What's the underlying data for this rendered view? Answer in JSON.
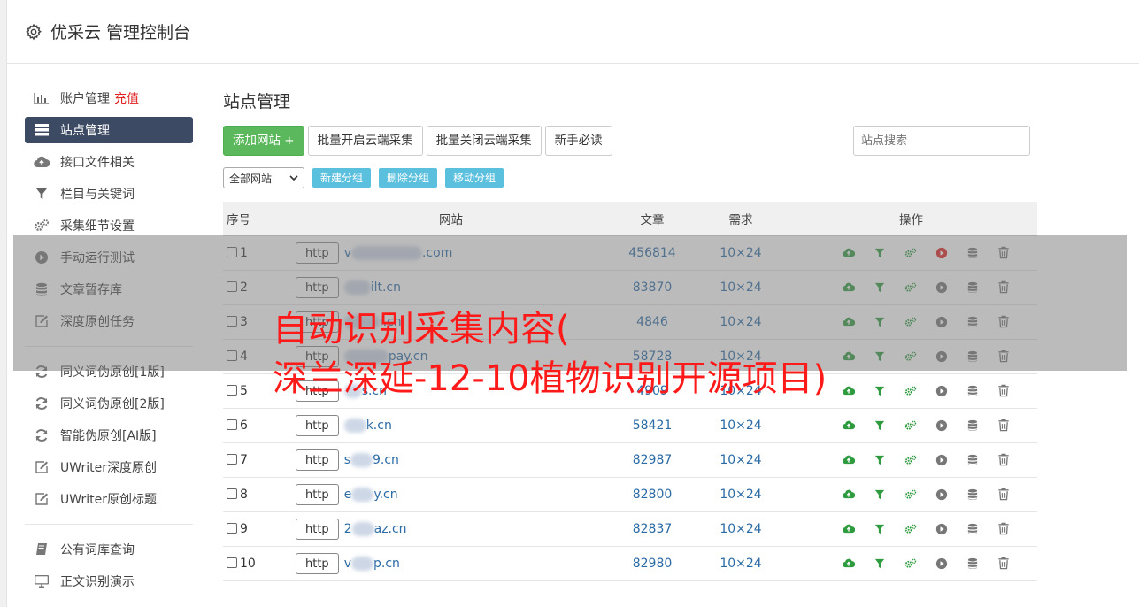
{
  "app": {
    "title": "优采云 管理控制台"
  },
  "sidebar": {
    "groups": [
      [
        {
          "icon": "bar-chart-icon",
          "label": "账户管理",
          "extra": "充值"
        },
        {
          "icon": "server-list-icon",
          "label": "站点管理",
          "active": true
        },
        {
          "icon": "cloud-upload-icon",
          "label": "接口文件相关"
        },
        {
          "icon": "filter-icon",
          "label": "栏目与关键词"
        },
        {
          "icon": "gears-icon",
          "label": "采集细节设置"
        },
        {
          "icon": "play-circle-icon",
          "label": "手动运行测试"
        },
        {
          "icon": "database-icon",
          "label": "文章暂存库"
        },
        {
          "icon": "edit-icon",
          "label": "深度原创任务"
        }
      ],
      [
        {
          "icon": "refresh-icon",
          "label": "同义词伪原创[1版]"
        },
        {
          "icon": "refresh-icon",
          "label": "同义词伪原创[2版]"
        },
        {
          "icon": "refresh-icon",
          "label": "智能伪原创[AI版]"
        },
        {
          "icon": "edit-icon",
          "label": "UWriter深度原创"
        },
        {
          "icon": "edit-icon",
          "label": "UWriter原创标题"
        }
      ],
      [
        {
          "icon": "book-icon",
          "label": "公有词库查询"
        },
        {
          "icon": "monitor-icon",
          "label": "正文识别演示"
        }
      ]
    ]
  },
  "main": {
    "title": "站点管理",
    "toolbar": {
      "add_site": "添加网站 +",
      "batch_open": "批量开启云端采集",
      "batch_close": "批量关闭云端采集",
      "newbie": "新手必读",
      "search_placeholder": "站点搜索"
    },
    "group_select": "全部网站",
    "group_buttons": {
      "new": "新建分组",
      "delete": "删除分组",
      "move": "移动分组"
    },
    "table": {
      "headers": {
        "no": "序号",
        "site": "网站",
        "articles": "文章",
        "need": "需求",
        "ops": "操作"
      },
      "http_label": "http",
      "rows": [
        {
          "no": "1",
          "prefix": "v",
          "suffix": ".com",
          "articles": "456814",
          "need": "10×24",
          "play_active": true
        },
        {
          "no": "2",
          "prefix": "",
          "suffix": "ilt.cn",
          "articles": "83870",
          "need": "10×24",
          "play_active": false
        },
        {
          "no": "3",
          "prefix": "",
          "suffix": "i.cn",
          "articles": "4846",
          "need": "10×24",
          "play_active": false
        },
        {
          "no": "4",
          "prefix": "",
          "suffix": "pay.cn",
          "articles": "58728",
          "need": "10×24",
          "play_active": false
        },
        {
          "no": "5",
          "prefix": "",
          "suffix": "s.cn",
          "articles": "4909",
          "need": "10×24",
          "play_active": false
        },
        {
          "no": "6",
          "prefix": "",
          "suffix": "k.cn",
          "articles": "58421",
          "need": "10×24",
          "play_active": false
        },
        {
          "no": "7",
          "prefix": "s",
          "suffix": "9.cn",
          "articles": "82987",
          "need": "10×24",
          "play_active": false
        },
        {
          "no": "8",
          "prefix": "e",
          "suffix": "y.cn",
          "articles": "82800",
          "need": "10×24",
          "play_active": false
        },
        {
          "no": "9",
          "prefix": "2",
          "suffix": "az.cn",
          "articles": "82837",
          "need": "10×24",
          "play_active": false
        },
        {
          "no": "10",
          "prefix": "v",
          "suffix": "p.cn",
          "articles": "82980",
          "need": "10×24",
          "play_active": false
        }
      ]
    }
  },
  "overlay": {
    "line1": "自动识别采集内容(",
    "line2": "深兰深延-12-10植物识别开源项目)"
  },
  "colors": {
    "green": "#2f9b3f",
    "red": "#e02020",
    "link": "#2a6aa5",
    "sidebar_active": "#3c4a63"
  }
}
